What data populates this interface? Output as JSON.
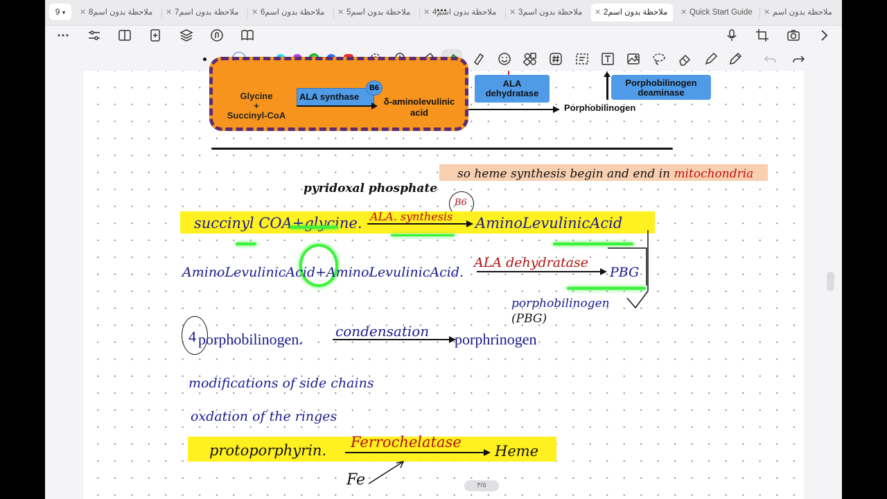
{
  "tabs": {
    "count": "9",
    "items": [
      {
        "label": "ملاحظة بدون اسم8"
      },
      {
        "label": "ملاحظة بدون اسم7"
      },
      {
        "label": "ملاحظة بدون اسم6"
      },
      {
        "label": "ملاحظة بدون اسم5"
      },
      {
        "label": "ملاحظة بدون اسم4"
      },
      {
        "label": "ملاحظة بدون اسم3"
      },
      {
        "label": "ملاحظة بدون اسم2"
      },
      {
        "label": "Quick Start Guide"
      },
      {
        "label": "ملاحظة بدون اسم"
      }
    ]
  },
  "toolbar_top": {
    "left_icons": [
      "more-icon",
      "sliders-icon",
      "sidebar-icon",
      "add-page-icon",
      "layers-icon",
      "hand-touch-icon",
      "book-icon"
    ],
    "right_icons": [
      "microphone-icon",
      "crop-icon",
      "camera-icon",
      "chevron-right-icon"
    ]
  },
  "toolbar_tools": {
    "pen_sizes": [
      "small",
      "medium",
      "large"
    ],
    "colors": [
      "#1ee0ee",
      "#b43ee8",
      "#2ec43a",
      "#2f6ef0",
      "#ee3030"
    ],
    "tool_icons": [
      "settings-icon",
      "zoom-icon",
      "ruler-icon",
      "highlighter-icon",
      "marker-icon",
      "emoji-icon",
      "shapes-icon",
      "hashtag-icon",
      "lasso-select-icon",
      "text-box-icon",
      "image-icon",
      "lasso-icon",
      "eraser-icon",
      "pen-icon",
      "pencil-icon",
      "undo-icon",
      "redo-icon"
    ]
  },
  "diagram": {
    "box_left_line1": "Glycine",
    "box_left_line2": "+",
    "box_left_line3": "Succinyl-CoA",
    "enzyme1": "ALA synthase",
    "cofactor": "B6",
    "product1_line1": "δ-aminolevulinic",
    "product1_line2": "acid",
    "enzyme2_line1": "ALA",
    "enzyme2_line2": "dehydratase",
    "product2": "Porphobilinogen",
    "enzyme3_line1": "Porphobilinogen",
    "enzyme3_line2": "deaminase"
  },
  "notes": {
    "heme_note_prefix": "so heme synthesis begin and end in ",
    "heme_note_emph": "mitochondria",
    "pyridoxal": "pyridoxal phosphate",
    "b6_circle": "B6",
    "line1_left": "succinyl COA+glycine.",
    "line1_enzyme": "ALA. synthesis",
    "line1_right": "AminoLevulinicAcid",
    "line2_left": "AminoLevulinicAcid+AminoLevulinicAcid.",
    "line2_enzyme": "ALA dehydratase",
    "line2_right": "PBG",
    "pbg_full": "porphobilinogen",
    "pbg_abbr": "(PBG)",
    "line3_coef": "4",
    "line3_left": "porphobilinogen.",
    "line3_enzyme": "condensation",
    "line3_right": "porphrinogen",
    "line4": "modifications of side chains",
    "line5": "oxdation of  the ringes",
    "line6_left": "protoporphyrin.",
    "line6_enzyme": "Ferrochelatase",
    "line6_right": "Heme",
    "fe": "Fe"
  },
  "page_indicator": "٣/٥",
  "colors": {
    "ink_blue": "#1a1a8c",
    "ink_red": "#b01010",
    "highlight_yellow": "#fff020",
    "highlight_green": "#39f23a",
    "note_bg": "#f8cfb0",
    "diagram_orange": "#f7941d",
    "diagram_purple": "#5b2c6f",
    "diagram_blue": "#4f9be8"
  }
}
